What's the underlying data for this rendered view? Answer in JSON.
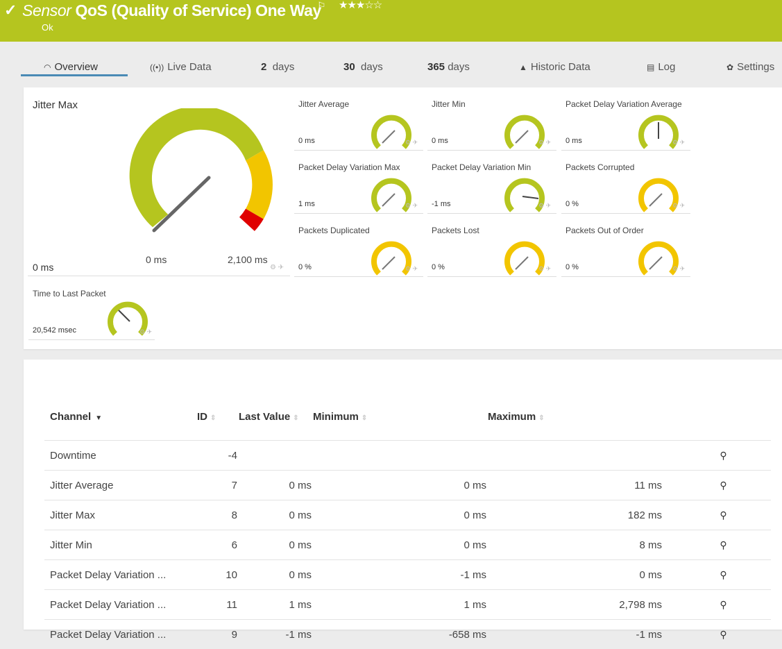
{
  "header": {
    "check_icon": "✓",
    "title_prefix": "Sensor",
    "title": "QoS (Quality of Service) One Way",
    "flag_icon": "⚐",
    "stars": "★★★☆☆",
    "status": "Ok",
    "bg_color": "#b5c51f"
  },
  "tabs": [
    {
      "icon": "◠",
      "label": "Overview"
    },
    {
      "icon": "((•))",
      "label": "Live Data"
    },
    {
      "num": "2",
      "label": "days"
    },
    {
      "num": "30",
      "label": "days"
    },
    {
      "num": "365",
      "label": "days"
    },
    {
      "icon": "▲",
      "label": "Historic Data"
    },
    {
      "icon": "▤",
      "label": "Log"
    },
    {
      "icon": "✿",
      "label": "Settings"
    }
  ],
  "big_gauge": {
    "title": "Jitter Max",
    "min_label": "0 ms",
    "max_label": "2,100 ms",
    "value": "0 ms",
    "tools": "⚙ ✈"
  },
  "gauges": [
    {
      "title": "Jitter Average",
      "value": "0 ms",
      "color": "#b5c51f",
      "tools": "⚙ ✈"
    },
    {
      "title": "Jitter Min",
      "value": "0 ms",
      "color": "#b5c51f",
      "tools": "⚙ ✈"
    },
    {
      "title": "Packet Delay Variation Average",
      "value": "0 ms",
      "color": "#b5c51f",
      "tools": "⚙ ✈"
    },
    {
      "title": "Packet Delay Variation Max",
      "value": "1 ms",
      "color": "#b5c51f",
      "tools": "⚙ ✈"
    },
    {
      "title": "Packet Delay Variation Min",
      "value": "-1 ms",
      "color": "#b5c51f",
      "tools": "⚙ ✈"
    },
    {
      "title": "Packets Corrupted",
      "value": "0 %",
      "color": "#f2c500",
      "tools": "⚙ ✈"
    },
    {
      "title": "Packets Duplicated",
      "value": "0 %",
      "color": "#f2c500",
      "tools": "⚙ ✈"
    },
    {
      "title": "Packets Lost",
      "value": "0 %",
      "color": "#f2c500",
      "tools": "⚙ ✈"
    },
    {
      "title": "Packets Out of Order",
      "value": "0 %",
      "color": "#f2c500",
      "tools": "⚙ ✈"
    },
    {
      "title": "Time to Last Packet",
      "value": "20,542 msec",
      "color": "#b5c51f",
      "tools": "⚙ ✈"
    }
  ],
  "table": {
    "headers": {
      "channel": "Channel",
      "id": "ID",
      "last": "Last Value",
      "min": "Minimum",
      "max": "Maximum"
    },
    "sort_icon": "⇕",
    "caret_icon": "▼",
    "action_icon": "⚲",
    "rows": [
      {
        "channel": "Downtime",
        "id": "-4",
        "last": "",
        "min": "",
        "max": ""
      },
      {
        "channel": "Jitter Average",
        "id": "7",
        "last": "0 ms",
        "min": "0 ms",
        "max": "11 ms"
      },
      {
        "channel": "Jitter Max",
        "id": "8",
        "last": "0 ms",
        "min": "0 ms",
        "max": "182 ms"
      },
      {
        "channel": "Jitter Min",
        "id": "6",
        "last": "0 ms",
        "min": "0 ms",
        "max": "8 ms"
      },
      {
        "channel": "Packet Delay Variation ...",
        "id": "10",
        "last": "0 ms",
        "min": "-1 ms",
        "max": "0 ms"
      },
      {
        "channel": "Packet Delay Variation ...",
        "id": "11",
        "last": "1 ms",
        "min": "1 ms",
        "max": "2,798 ms"
      },
      {
        "channel": "Packet Delay Variation ...",
        "id": "9",
        "last": "-1 ms",
        "min": "-658 ms",
        "max": "-1 ms"
      }
    ]
  }
}
